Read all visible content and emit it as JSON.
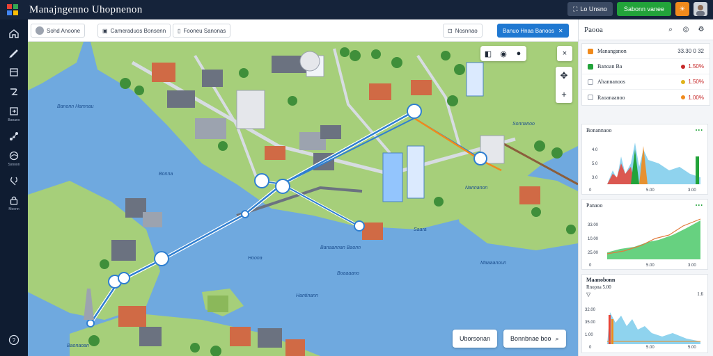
{
  "app": {
    "title": "Manajngenno Uhopnenon"
  },
  "topbar": {
    "dark_button": "Lo Unsno",
    "green_button": "Sabonn vanee",
    "orange_icon": "sun-icon",
    "avatar_icon": "user-avatar-icon"
  },
  "rail": {
    "items": [
      {
        "icon": "home-icon",
        "label": ""
      },
      {
        "icon": "pen-icon",
        "label": ""
      },
      {
        "icon": "layers-icon",
        "label": ""
      },
      {
        "icon": "route-icon",
        "label": ""
      },
      {
        "icon": "export-icon",
        "label": "Banano"
      },
      {
        "icon": "network-icon",
        "label": ""
      },
      {
        "icon": "globe-icon",
        "label": "Ssnoon"
      },
      {
        "icon": "settings-icon",
        "label": ""
      },
      {
        "icon": "lock-icon",
        "label": "Moenn"
      }
    ],
    "bottom_icon": "help-icon"
  },
  "toolbar": {
    "chip1": "Sohd Anoone",
    "chip2": "Cameraduos Bonsenn",
    "chip3": "Fooneu Sanonas",
    "chip4": "Nosnnao",
    "blue_button": "Banuo Hnaa Banoos"
  },
  "map": {
    "labels": [
      "Banonn Hamnau",
      "Bonna",
      "Nannanon",
      "Sonnanoo",
      "Saara",
      "Banaannan Baonn",
      "Maaaanoun",
      "Hoona",
      "Boaaaano",
      "Hantinann",
      "Baonaoan"
    ],
    "bottom_left_button": "Uborsonan",
    "bottom_right_button": "Bonnbnae boo",
    "zoom_in": "+",
    "zoom_pan": "move-icon",
    "close": "×"
  },
  "panel": {
    "title": "Paooa",
    "legend": [
      {
        "label": "Mananganon",
        "value": "33.30 0 32",
        "color": "#f08a1c",
        "dot": ""
      },
      {
        "label": "Banoan Ba",
        "value": "1.50%",
        "color": "#22a33a",
        "dot": "#c62828"
      },
      {
        "label": "Ahannanoos",
        "value": "1.50%",
        "color": "#ffffff",
        "dot": "#e0b21a"
      },
      {
        "label": "Raoanaanoo",
        "value": "1.00%",
        "color": "#ffffff",
        "dot": "#f08a1c"
      }
    ],
    "card1": {
      "title": "Bonannaoo",
      "yticks": [
        "4.0",
        "5.0",
        "3.0"
      ],
      "xticks": [
        "0",
        "5.00",
        "3.00"
      ]
    },
    "card2": {
      "title": "Panaoo",
      "yticks": [
        "33.00",
        "10.00",
        "25.00"
      ],
      "xticks": [
        "0",
        "5.00",
        "3.00"
      ]
    },
    "card3": {
      "title": "Maanobonn",
      "subtitle": "Rnopna 5.00",
      "yticks": [
        "32.00",
        "35.00",
        "1.00"
      ],
      "xticks": [
        "0",
        "5.00",
        "5.00"
      ],
      "top_right": "1.6"
    }
  },
  "colors": {
    "topbar": "#15233a",
    "rail": "#0f1c31",
    "accent_blue": "#1f78d1",
    "accent_green": "#22a33a",
    "accent_orange": "#f08a1c",
    "water": "#6fa9df",
    "land": "#a6cf7a"
  }
}
